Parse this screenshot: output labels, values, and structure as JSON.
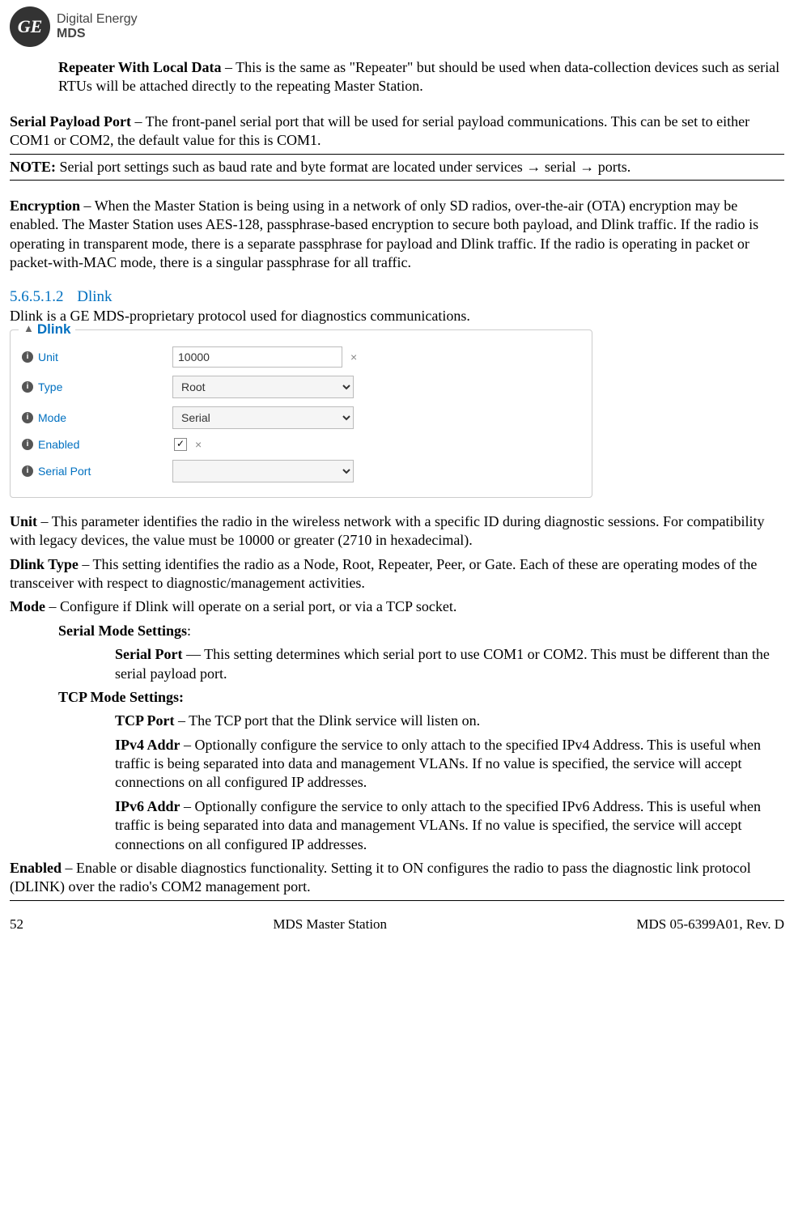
{
  "logo": {
    "ge": "GE",
    "topText": "Digital Energy",
    "bottomText": "MDS"
  },
  "para_repeater": {
    "bold": "Repeater With Local Data",
    "text": " – This is the same as \"Repeater\" but should be used when data-collection devices such as serial RTUs will be attached directly to the repeating Master Station."
  },
  "para_serialPayload": {
    "bold": "Serial Payload Port",
    "text": " – The front-panel serial port that will be used for serial payload communications. This can be set to either COM1 or COM2, the default value for this is COM1."
  },
  "note": {
    "bold": "NOTE:",
    "t1": " Serial port settings such as baud rate and byte format are located under services ",
    "arrow": "→",
    "t2": " serial ",
    "t3": " ports."
  },
  "para_encryption": {
    "bold": "Encryption",
    "text": " – When the Master Station is being using in a network of only SD radios, over-the-air (OTA) encryption may be enabled. The Master Station uses AES-128, passphrase-based encryption to secure both payload, and Dlink traffic. If the radio is operating in transparent mode, there is a separate passphrase for payload and Dlink traffic. If the radio is operating in packet or packet-with-MAC mode, there is a singular passphrase for all traffic."
  },
  "heading_dlink": {
    "num": "5.6.5.1.2",
    "title": "Dlink"
  },
  "dlink_intro": "Dlink is a GE MDS-proprietary protocol used for diagnostics communications.",
  "dlink_box": {
    "legend": "Dlink",
    "unit_label": "Unit",
    "unit_value": "10000",
    "type_label": "Type",
    "type_value": "Root",
    "mode_label": "Mode",
    "mode_value": "Serial",
    "enabled_label": "Enabled",
    "enabled_checked": "✓",
    "serialport_label": "Serial Port",
    "serialport_value": ""
  },
  "def_unit": {
    "bold": "Unit",
    "text": " – This parameter identifies the radio in the wireless network with a specific ID during diagnostic sessions. For compatibility with legacy devices, the value must be 10000 or greater (2710 in hexadecimal)."
  },
  "def_dlinktype": {
    "bold": "Dlink Type",
    "text": " – This setting identifies the radio as a Node, Root, Repeater, Peer, or Gate. Each of these are operating modes of the transceiver with respect to diagnostic/management activities."
  },
  "def_mode": {
    "bold": "Mode",
    "text": " – Configure if Dlink will operate on a serial port, or via a TCP socket."
  },
  "sms_heading": "Serial Mode Settings",
  "sms_colon": ":",
  "def_serialport": {
    "bold": "Serial Port",
    "text": " — This setting determines which serial port to use COM1 or COM2. This must be different than the serial payload port."
  },
  "tms_heading": "TCP Mode Settings:",
  "def_tcpport": {
    "bold": "TCP Port",
    "text": " – The TCP port that the Dlink service will listen on."
  },
  "def_ipv4": {
    "bold": "IPv4 Addr",
    "text": " – Optionally configure the service to only attach to the specified IPv4 Address. This is useful when traffic is being separated into data and management VLANs. If no value is specified, the service will accept connections on all configured IP addresses."
  },
  "def_ipv6": {
    "bold": "IPv6 Addr",
    "text": " – Optionally configure the service to only attach to the specified IPv6 Address. This is useful when traffic is being separated into data and management VLANs. If no value is specified, the service will accept connections on all configured IP addresses."
  },
  "def_enabled": {
    "bold": "Enabled",
    "text": " – Enable or disable diagnostics functionality. Setting it to ON configures the radio to pass the diagnostic link protocol (DLINK) over the radio's COM2 management port."
  },
  "footer": {
    "page": "52",
    "center": "MDS Master Station",
    "right": "MDS 05-6399A01, Rev. D"
  }
}
